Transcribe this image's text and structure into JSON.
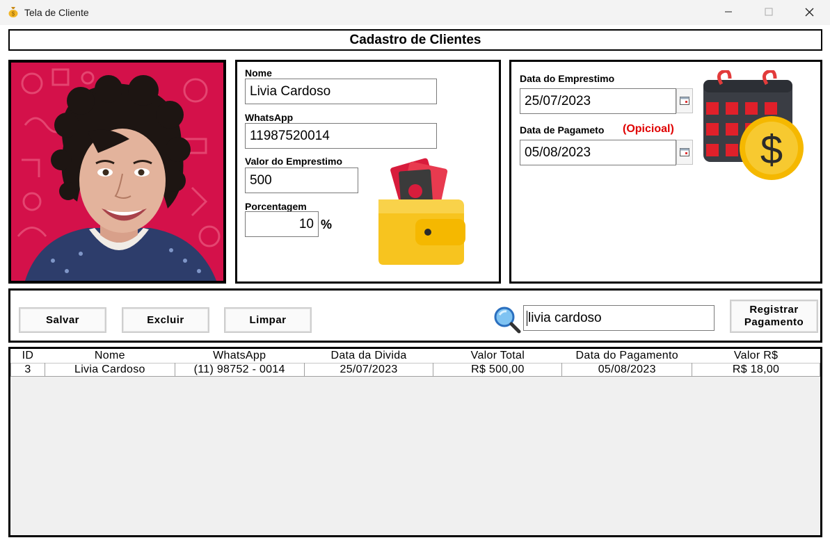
{
  "window": {
    "title": "Tela de Cliente",
    "minimize_symbol": "—",
    "maximize_symbol": "☐",
    "close_symbol": "✕",
    "app_icon": "money-bag-icon"
  },
  "header": {
    "title": "Cadastro de Clientes"
  },
  "photo": {
    "description_icon": "client-photo"
  },
  "form": {
    "nome_label": "Nome",
    "nome_value": "Livia Cardoso",
    "whatsapp_label": "WhatsApp",
    "whatsapp_value": "11987520014",
    "valor_label": "Valor do Emprestimo",
    "valor_value": "500",
    "porcentagem_label": "Porcentagem",
    "porcentagem_value": "10",
    "percent_sign": "%",
    "wallet_icon": "wallet-icon"
  },
  "dates": {
    "emprestimo_label": "Data do Emprestimo",
    "emprestimo_value": "25/07/2023",
    "pagamento_label": "Data de Pagameto",
    "pagamento_optional": "(Opicioal)",
    "pagamento_value": "05/08/2023",
    "calendar_icon": "calendar-dollar-icon"
  },
  "actions": {
    "salvar": "Salvar",
    "excluir": "Excluir",
    "limpar": "Limpar",
    "search_value": "livia cardoso",
    "registrar_line1": "Registrar",
    "registrar_line2": "Pagamento"
  },
  "table": {
    "columns": [
      "ID",
      "Nome",
      "WhatsApp",
      "Data da Divida",
      "Valor Total",
      "Data do Pagamento",
      "Valor R$"
    ],
    "rows": [
      [
        "3",
        "Livia Cardoso",
        "(11) 98752 - 0014",
        "25/07/2023",
        "R$ 500,00",
        "05/08/2023",
        "R$ 18,00"
      ]
    ]
  },
  "colors": {
    "photo_bg": "#d4114a",
    "wallet": "#f7c41f",
    "accent_red": "#e00000",
    "calendar_body": "#3a3d44"
  }
}
